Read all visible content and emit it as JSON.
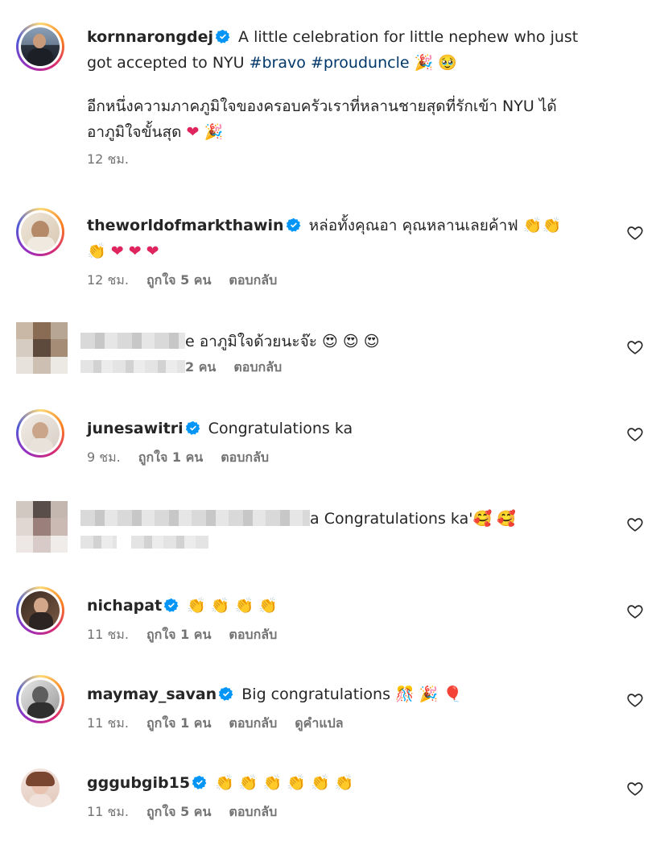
{
  "post": {
    "username": "kornnarongdej",
    "caption_en_before": "A little celebration for little nephew who just",
    "caption_en_line2": "got accepted to NYU ",
    "hashtag1": "#bravo",
    "hashtag2": "#proudunclе",
    "caption_th_line1": "อีกหนึ่งความภาคภูมิใจของครอบครัวเราที่หลานชายสุดที่รักเข้า NYU ได้",
    "caption_th_line2": "อาภูมิใจขั้นสุด",
    "time": "12 ชม."
  },
  "comments": [
    {
      "username": "theworldofmarkthawin",
      "text": "หล่อทั้งคุณอา คุณหลานเลยค้าฟ",
      "time": "12 ชม.",
      "likes": "ถูกใจ 5 คน",
      "reply": "ตอบกลับ"
    },
    {
      "username_suffix": "e",
      "text": "อาภูมิใจด้วยนะจ๊ะ",
      "likes_suffix": "2 คน",
      "reply": "ตอบกลับ"
    },
    {
      "username": "junesawitri",
      "text": "Congratulations ka",
      "time": "9 ชม.",
      "likes": "ถูกใจ 1 คน",
      "reply": "ตอบกลับ"
    },
    {
      "username_suffix": "a",
      "text": "Congratulations ka'"
    },
    {
      "username": "nichapat",
      "time": "11 ชม.",
      "likes": "ถูกใจ 1 คน",
      "reply": "ตอบกลับ"
    },
    {
      "username": "maymay_savan",
      "text": "Big congratulations",
      "time": "11 ชม.",
      "likes": "ถูกใจ 1 คน",
      "reply": "ตอบกลับ",
      "translate": "ดูคำแปล"
    },
    {
      "username": "gggubgib15",
      "time": "11 ชม.",
      "likes": "ถูกใจ 5 คน",
      "reply": "ตอบกลับ"
    }
  ],
  "colors": {
    "verified": "#0095f6",
    "hashtag": "#00376b",
    "meta": "#737373",
    "text": "#262626"
  },
  "icons": {
    "verified": "verified-badge-icon",
    "like": "heart-outline-icon"
  }
}
